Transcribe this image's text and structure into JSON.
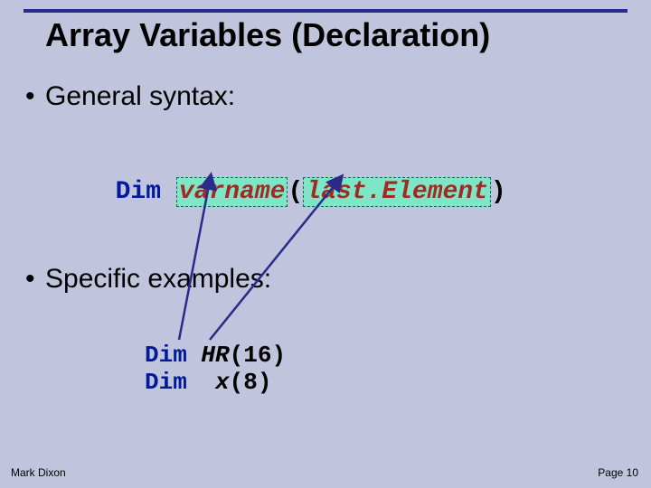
{
  "title": "Array Variables (Declaration)",
  "bullets": {
    "general": "General syntax:",
    "specific": "Specific examples:"
  },
  "syntax": {
    "keyword": "Dim",
    "varname": "varname",
    "open": "(",
    "lastElement": "last.Element",
    "close": ")"
  },
  "examples": {
    "line1": {
      "keyword": "Dim",
      "ident": "HR",
      "args": "(16)",
      "leading": " "
    },
    "line2": {
      "keyword": "Dim",
      "ident": "x",
      "args": "(8)",
      "leading": "  "
    }
  },
  "footer": {
    "author": "Mark Dixon",
    "page": "Page 10"
  }
}
